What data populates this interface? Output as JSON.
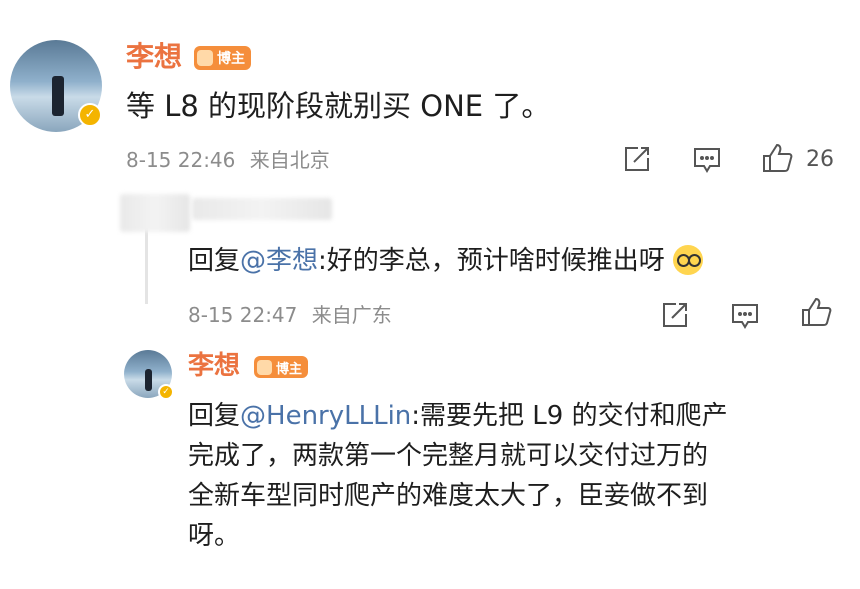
{
  "post": {
    "author": "李想",
    "badge": "博主",
    "content": "等 L8 的现阶段就别买 ONE 了。",
    "time": "8-15 22:46",
    "location": "来自北京",
    "likes": "26"
  },
  "reply1": {
    "prefix": "回复",
    "mention": "@李想",
    "text": ":好的李总，预计啥时候推出呀",
    "time": "8-15 22:47",
    "location": "来自广东"
  },
  "reply2": {
    "author": "李想",
    "badge": "博主",
    "prefix": "回复",
    "mention": "@HenryLLLin",
    "line1": ":需要先把 L9 的交付和爬产",
    "line2": "完成了，两款第一个完整月就可以交付过万的",
    "line3": "全新车型同时爬产的难度太大了，臣妾做不到",
    "line4": "呀。"
  }
}
